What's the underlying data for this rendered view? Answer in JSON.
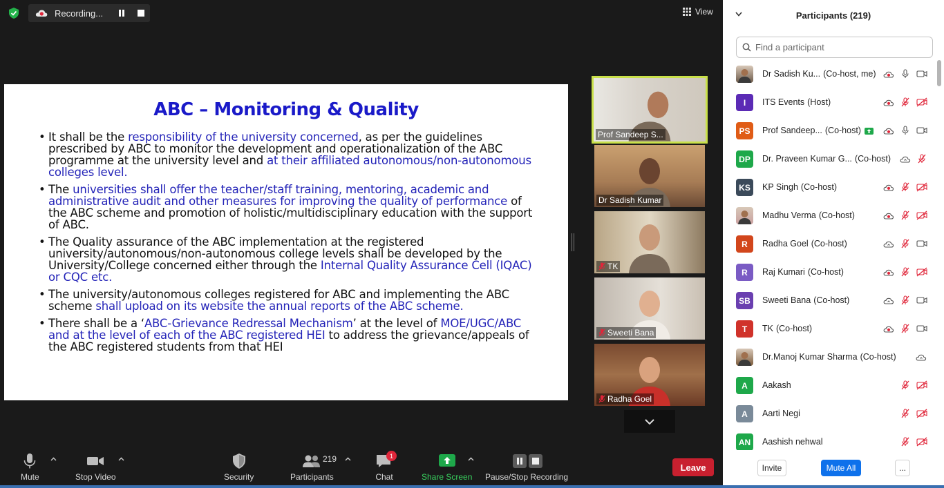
{
  "top": {
    "recording_label": "Recording...",
    "view_label": "View"
  },
  "slide": {
    "title": "ABC – Monitoring & Quality",
    "bullets": [
      [
        {
          "t": "It shall be the "
        },
        {
          "t": "responsibility of the university concerned",
          "hl": true
        },
        {
          "t": ", as per the guidelines prescribed by ABC to monitor the development and operationalization of the ABC programme at the university level and "
        },
        {
          "t": "at their affiliated autonomous/non-autonomous colleges level.",
          "hl": true
        }
      ],
      [
        {
          "t": "The "
        },
        {
          "t": "universities shall offer the teacher/staff training, mentoring, academic and administrative audit and other measures for improving the quality of performance",
          "hl": true
        },
        {
          "t": " of the ABC scheme and promotion of holistic/multidisciplinary education with the support of ABC."
        }
      ],
      [
        {
          "t": "The Quality assurance of the ABC implementation at the registered university/autonomous/non-autonomous college levels shall be developed by the University/College concerned either through the "
        },
        {
          "t": "Internal Quality Assurance Cell (IQAC) or CQC etc.",
          "hl": true
        }
      ],
      [
        {
          "t": "The university/autonomous colleges registered for ABC and implementing the ABC scheme "
        },
        {
          "t": "shall upload on its website the annual reports of the ABC scheme.",
          "hl": true
        }
      ],
      [
        {
          "t": "There shall be a ‘"
        },
        {
          "t": "ABC-Grievance Redressal Mechanism",
          "hl": true
        },
        {
          "t": "’ at the level of "
        },
        {
          "t": "MOE/UGC/ABC and at the level of each of the ABC registered HEI",
          "hl": true
        },
        {
          "t": " to address the grievance/appeals of the ABC registered students from that HEI"
        }
      ]
    ]
  },
  "videos": [
    {
      "name": "Prof Sandeep S...",
      "muted": false,
      "active": true
    },
    {
      "name": "Dr Sadish Kumar",
      "muted": false,
      "active": false
    },
    {
      "name": "TK",
      "muted": true,
      "active": false
    },
    {
      "name": "Sweeti Bana",
      "muted": true,
      "active": false
    },
    {
      "name": "Radha Goel",
      "muted": true,
      "active": false
    }
  ],
  "toolbar": {
    "mute": "Mute",
    "stop_video": "Stop Video",
    "security": "Security",
    "participants": "Participants",
    "participants_count": "219",
    "chat": "Chat",
    "chat_badge": "1",
    "share_screen": "Share Screen",
    "recording": "Pause/Stop Recording",
    "leave": "Leave"
  },
  "panel": {
    "title": "Participants (219)",
    "search_placeholder": "Find a participant",
    "participants": [
      {
        "name": "Dr Sadish Ku...",
        "role": "(Co-host, me)",
        "initials": "",
        "color": "#6b5a4a",
        "photo": true,
        "rec": true,
        "mic": "on",
        "cam": "on"
      },
      {
        "name": "ITS Events",
        "role": "(Host)",
        "initials": "I",
        "color": "#5b2bb5",
        "photo": false,
        "rec": true,
        "mic": "off",
        "cam": "off"
      },
      {
        "name": "Prof Sandeep...",
        "role": "(Co-host)",
        "initials": "PS",
        "color": "#e05c16",
        "photo": false,
        "rec": true,
        "mic": "on",
        "cam": "on",
        "sharing": true
      },
      {
        "name": "Dr. Praveen Kumar G...",
        "role": "(Co-host)",
        "initials": "DP",
        "color": "#1ea84a",
        "photo": false,
        "rec": false,
        "mic": "off",
        "cam": "none"
      },
      {
        "name": "KP Singh",
        "role": "(Co-host)",
        "initials": "KS",
        "color": "#3b4a5a",
        "photo": false,
        "rec": true,
        "mic": "off",
        "cam": "off"
      },
      {
        "name": "Madhu Verma",
        "role": "(Co-host)",
        "initials": "",
        "color": "#c9a0a0",
        "photo": true,
        "rec": true,
        "mic": "off",
        "cam": "off"
      },
      {
        "name": "Radha Goel",
        "role": "(Co-host)",
        "initials": "R",
        "color": "#d2461c",
        "photo": false,
        "rec": false,
        "mic": "off",
        "cam": "on"
      },
      {
        "name": "Raj Kumari",
        "role": "(Co-host)",
        "initials": "R",
        "color": "#7a5bc4",
        "photo": false,
        "rec": true,
        "mic": "off",
        "cam": "off"
      },
      {
        "name": "Sweeti Bana",
        "role": "(Co-host)",
        "initials": "SB",
        "color": "#6a3fb0",
        "photo": false,
        "rec": false,
        "mic": "off",
        "cam": "on"
      },
      {
        "name": "TK",
        "role": "(Co-host)",
        "initials": "T",
        "color": "#d0322a",
        "photo": false,
        "rec": true,
        "mic": "off",
        "cam": "on"
      },
      {
        "name": "Dr.Manoj Kumar Sharma",
        "role": "(Co-host)",
        "initials": "",
        "color": "#7a5a3a",
        "photo": true,
        "rec": false,
        "mic": "none",
        "cam": "none"
      },
      {
        "name": "Aakash",
        "role": "",
        "initials": "A",
        "color": "#1ea84a",
        "photo": false,
        "rec": "none",
        "mic": "off",
        "cam": "off"
      },
      {
        "name": "Aarti Negi",
        "role": "",
        "initials": "A",
        "color": "#7a8a99",
        "photo": false,
        "rec": "none",
        "mic": "off",
        "cam": "off"
      },
      {
        "name": "Aashish nehwal",
        "role": "",
        "initials": "AN",
        "color": "#1ea84a",
        "photo": false,
        "rec": "none",
        "mic": "off",
        "cam": "off"
      }
    ],
    "invite": "Invite",
    "mute_all": "Mute All",
    "more": "..."
  }
}
